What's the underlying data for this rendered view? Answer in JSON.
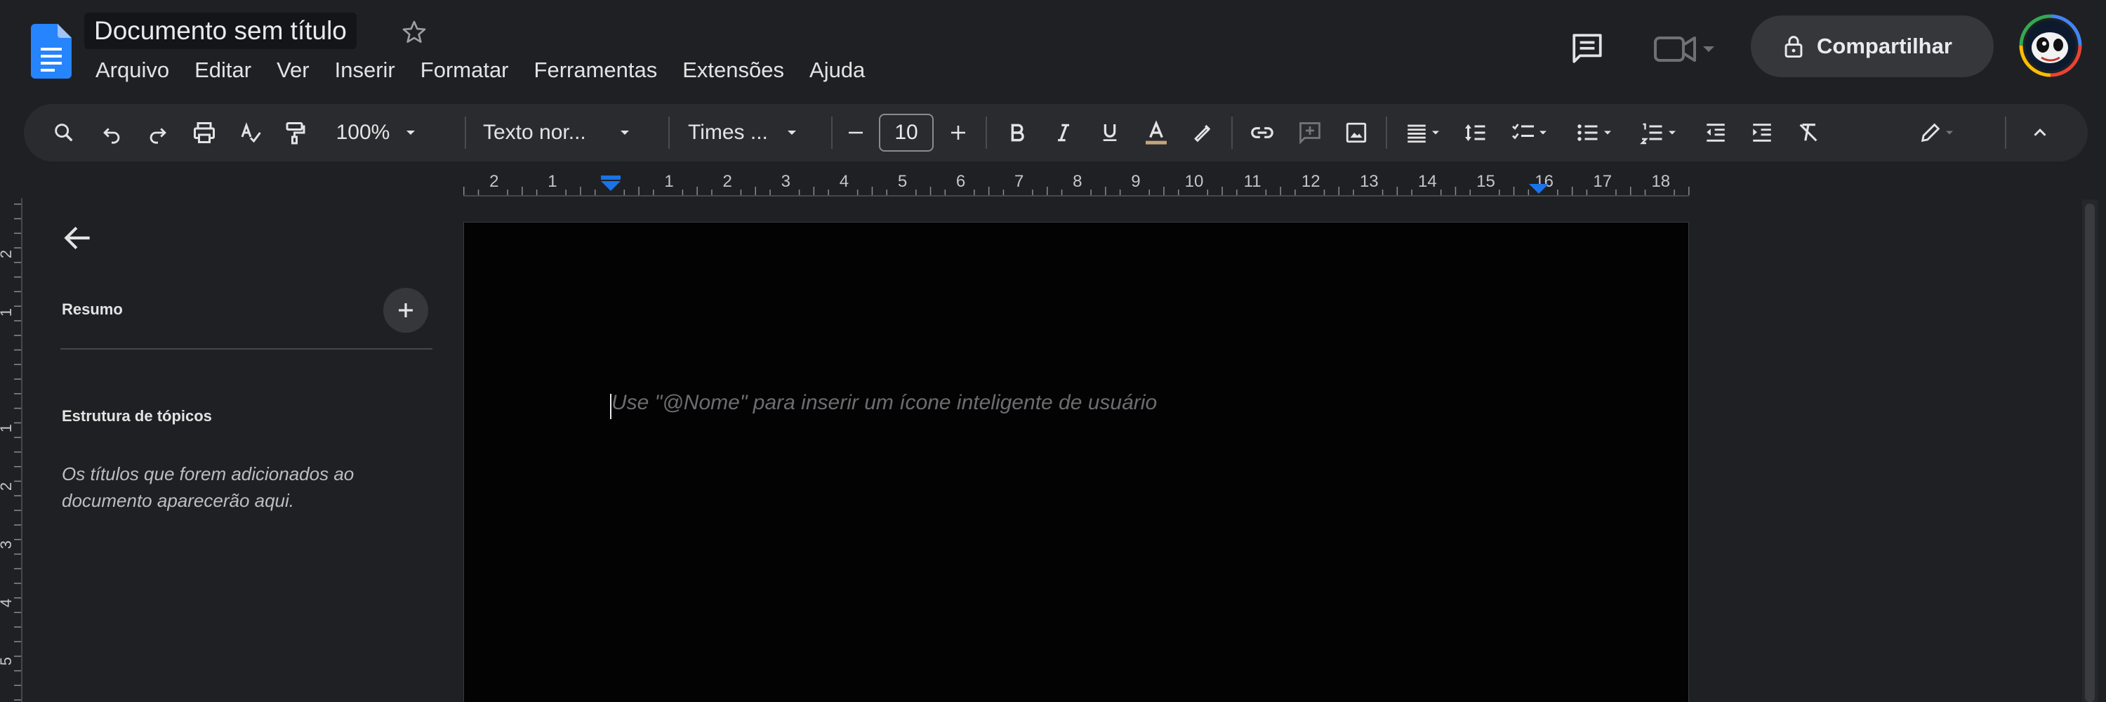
{
  "header": {
    "title": "Documento sem título",
    "share_label": "Compartilhar"
  },
  "menu": [
    "Arquivo",
    "Editar",
    "Ver",
    "Inserir",
    "Formatar",
    "Ferramentas",
    "Extensões",
    "Ajuda"
  ],
  "toolbar": {
    "zoom": "100%",
    "style": "Texto nor...",
    "font": "Times ...",
    "font_size": "10"
  },
  "ruler": {
    "left_numbers": [
      "2",
      "1"
    ],
    "numbers": [
      "1",
      "2",
      "3",
      "4",
      "5",
      "6",
      "7",
      "8",
      "9",
      "10",
      "11",
      "12",
      "13",
      "14",
      "15",
      "16",
      "17",
      "18"
    ],
    "vertical_numbers": [
      "2",
      "1",
      "1",
      "2",
      "3",
      "4",
      "5"
    ]
  },
  "outline": {
    "summary_label": "Resumo",
    "headings_label": "Estrutura de tópicos",
    "empty_hint": "Os títulos que forem adicionados ao documento aparecerão aqui."
  },
  "document": {
    "placeholder": "Use \"@Nome\" para inserir um ícone inteligente de usuário"
  },
  "colors": {
    "background": "#1f2023",
    "page": "#030303",
    "accent_blue": "#1a73e8",
    "text_color_bar": "#c5a47e"
  },
  "icons": [
    "docs-logo-icon",
    "star-icon",
    "comment-icon",
    "meet-icon",
    "lock-icon",
    "search-icon",
    "undo-icon",
    "redo-icon",
    "print-icon",
    "spellcheck-icon",
    "paint-format-icon",
    "bold-icon",
    "italic-icon",
    "underline-icon",
    "text-color-icon",
    "highlight-icon",
    "link-icon",
    "add-comment-icon",
    "image-icon",
    "align-icon",
    "line-spacing-icon",
    "checklist-icon",
    "bullet-list-icon",
    "numbered-list-icon",
    "decrease-indent-icon",
    "increase-indent-icon",
    "clear-formatting-icon",
    "editing-mode-icon",
    "collapse-icon",
    "back-arrow-icon",
    "plus-icon"
  ]
}
